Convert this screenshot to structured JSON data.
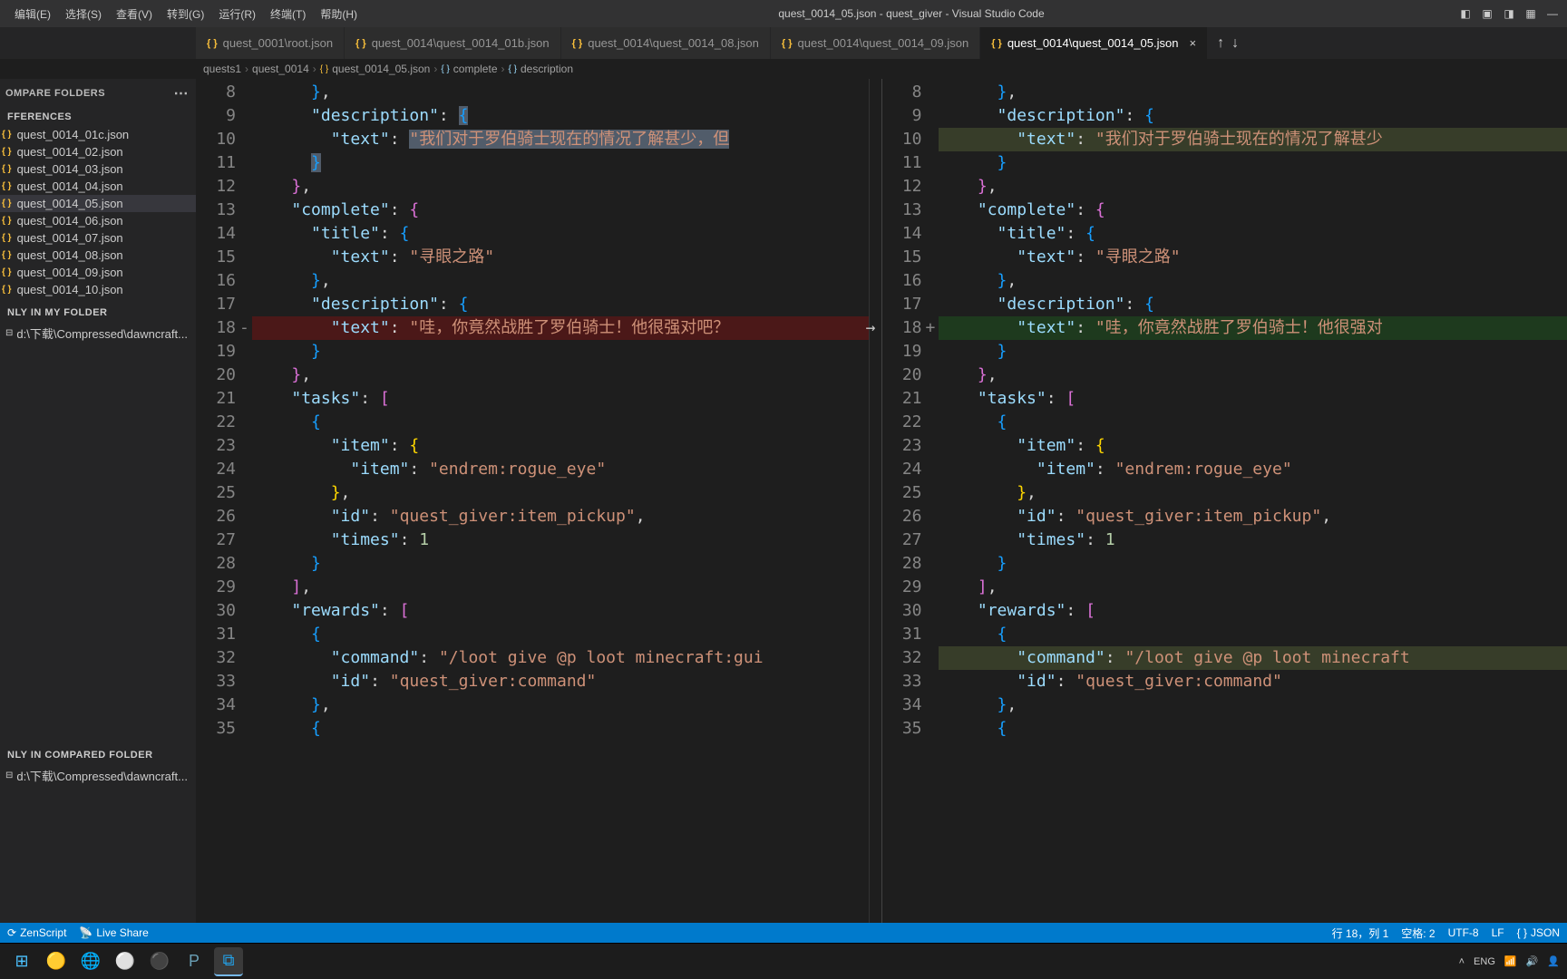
{
  "window": {
    "title": "quest_0014_05.json - quest_giver - Visual Studio Code"
  },
  "menu": {
    "items": [
      "编辑(E)",
      "选择(S)",
      "查看(V)",
      "转到(G)",
      "运行(R)",
      "终端(T)",
      "帮助(H)"
    ]
  },
  "tabs": {
    "items": [
      {
        "label": "quest_0001\\root.json"
      },
      {
        "label": "quest_0014\\quest_0014_01b.json"
      },
      {
        "label": "quest_0014\\quest_0014_08.json"
      },
      {
        "label": "quest_0014\\quest_0014_09.json"
      },
      {
        "label": "quest_0014\\quest_0014_05.json",
        "active": true
      }
    ]
  },
  "breadcrumb": {
    "items": [
      "quests1",
      "quest_0014",
      "quest_0014_05.json",
      "complete",
      "description"
    ]
  },
  "sidebar": {
    "header": "OMPARE FOLDERS",
    "section1": "FFERENCES",
    "files": [
      "quest_0014_01c.json",
      "quest_0014_02.json",
      "quest_0014_03.json",
      "quest_0014_04.json",
      "quest_0014_05.json",
      "quest_0014_06.json",
      "quest_0014_07.json",
      "quest_0014_08.json",
      "quest_0014_09.json",
      "quest_0014_10.json"
    ],
    "active_index": 4,
    "only_my": "NLY IN MY FOLDER",
    "only_comp": "NLY IN COMPARED FOLDER",
    "folder_path": "d:\\下载\\Compressed\\dawncraft..."
  },
  "code": {
    "line_numbers": [
      "8",
      "9",
      "10",
      "11",
      "12",
      "13",
      "14",
      "15",
      "16",
      "17",
      "18",
      "19",
      "20",
      "21",
      "22",
      "23",
      "24",
      "25",
      "26",
      "27",
      "28",
      "29",
      "30",
      "31",
      "32",
      "33",
      "34",
      "35"
    ],
    "lines_left": {
      "l9_desc": "\"description\"",
      "l10_text": "\"text\"",
      "l10_val": "\"我们对于罗伯骑士现在的情况了解甚少，但",
      "l13_complete": "\"complete\"",
      "l14_title": "\"title\"",
      "l15_text": "\"text\"",
      "l15_val": "\"寻眼之路\"",
      "l17_desc": "\"description\"",
      "l18_text": "\"text\"",
      "l18_val": "\"哇，你竟然战胜了罗伯骑士！他很强对吧？",
      "l21_tasks": "\"tasks\"",
      "l23_item": "\"item\"",
      "l24_item": "\"item\"",
      "l24_val": "\"endrem:rogue_eye\"",
      "l26_id": "\"id\"",
      "l26_val": "\"quest_giver:item_pickup\"",
      "l27_times": "\"times\"",
      "l27_val": "1",
      "l30_rewards": "\"rewards\"",
      "l32_cmd": "\"command\"",
      "l32_val": "\"/loot give @p loot minecraft:gui",
      "l33_id": "\"id\"",
      "l33_val": "\"quest_giver:command\""
    },
    "lines_right": {
      "l10_val": "\"我们对于罗伯骑士现在的情况了解甚少",
      "l18_val": "\"哇，你竟然战胜了罗伯骑士！他很强对",
      "l32_val": "\"/loot give @p loot minecraft"
    }
  },
  "status": {
    "zen": "ZenScript",
    "live": "Live Share",
    "pos": "行 18，列 1",
    "spaces": "空格: 2",
    "enc": "UTF-8",
    "eol": "LF",
    "lang": "JSON"
  },
  "tray": {
    "ime": "ENG"
  }
}
